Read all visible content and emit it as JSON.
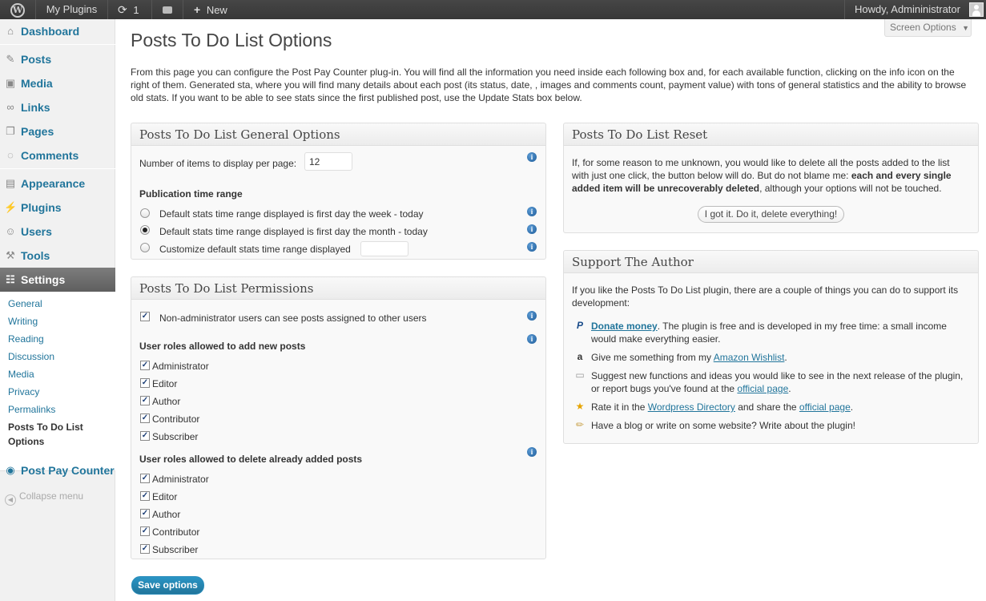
{
  "adminbar": {
    "site_name": "My Plugins",
    "updates_count": "1",
    "new_label": "New",
    "howdy": "Howdy, Admininistrator"
  },
  "sidebar": {
    "items": [
      {
        "label": "Dashboard",
        "icon": "dashboard-icon"
      },
      {
        "label": "Posts",
        "icon": "pin-icon"
      },
      {
        "label": "Media",
        "icon": "media-icon"
      },
      {
        "label": "Links",
        "icon": "link-icon"
      },
      {
        "label": "Pages",
        "icon": "pages-icon"
      },
      {
        "label": "Comments",
        "icon": "comment-icon"
      },
      {
        "label": "Appearance",
        "icon": "appearance-icon"
      },
      {
        "label": "Plugins",
        "icon": "plugin-icon"
      },
      {
        "label": "Users",
        "icon": "users-icon"
      },
      {
        "label": "Tools",
        "icon": "tools-icon"
      },
      {
        "label": "Settings",
        "icon": "settings-icon"
      }
    ],
    "submenu": [
      "General",
      "Writing",
      "Reading",
      "Discussion",
      "Media",
      "Privacy",
      "Permalinks",
      "Posts To Do List Options"
    ],
    "extra_item": "Post Pay Counter",
    "collapse": "Collapse menu"
  },
  "screen_options": "Screen Options",
  "page_title": "Posts To Do List Options",
  "intro": "From this page you can configure the Post Pay Counter plug-in. You will find all the information you need inside each following box and, for each available function, clicking on the info icon on the right of them. Generated sta, where you will find many details about each post (its status, date, , images and comments count, payment value) with tons of general statistics and the ability to browse old stats. If you want to be able to see stats since the first published post, use the Update Stats box below.",
  "general": {
    "title": "Posts To Do List General Options",
    "items_label": "Number of items to display per page:",
    "items_value": "12",
    "range_heading": "Publication time range",
    "range_options": [
      "Default stats time range displayed is first day the week - today",
      "Default stats time range displayed is first day the month - today",
      "Customize default stats time range displayed"
    ],
    "selected_range": 1
  },
  "permissions": {
    "title": "Posts To Do List Permissions",
    "non_admin_label": "Non-administrator users can see posts assigned to other users",
    "add_heading": "User roles allowed to add new posts",
    "delete_heading": "User roles allowed to delete already added posts",
    "roles": [
      "Administrator",
      "Editor",
      "Author",
      "Contributor",
      "Subscriber"
    ]
  },
  "reset": {
    "title": "Posts To Do List Reset",
    "text_before": "If, for some reason to me unknown, you would like to delete all the posts added to the list with just one click, the button below will do. But do not blame me: ",
    "text_bold": "each and every single added item will be unrecoverably deleted",
    "text_after": ", although your options will not be touched.",
    "button": "I got it. Do it, delete everything!"
  },
  "support": {
    "title": "Support The Author",
    "intro": "If you like the Posts To Do List plugin, there are a couple of things you can do to support its development:",
    "donate_link": "Donate money",
    "donate_text": ". The plugin is free and is developed in my free time: a small income would make everything easier.",
    "wishlist_before": "Give me something from my ",
    "wishlist_link": "Amazon Wishlist",
    "wishlist_after": ".",
    "suggest_before": "Suggest new functions and ideas you would like to see in the next release of the plugin, or report bugs you've found at the ",
    "suggest_link": "official page",
    "suggest_after": ".",
    "rate_before": "Rate it in the ",
    "rate_link": "Wordpress Directory",
    "rate_mid": " and share the ",
    "rate_link2": "official page",
    "rate_after": ".",
    "blog_text": "Have a blog or write on some website? Write about the plugin!"
  },
  "save_button": "Save options",
  "colors": {
    "link": "#21759b",
    "adminbar": "#464646",
    "primary_button": "#21759b"
  }
}
